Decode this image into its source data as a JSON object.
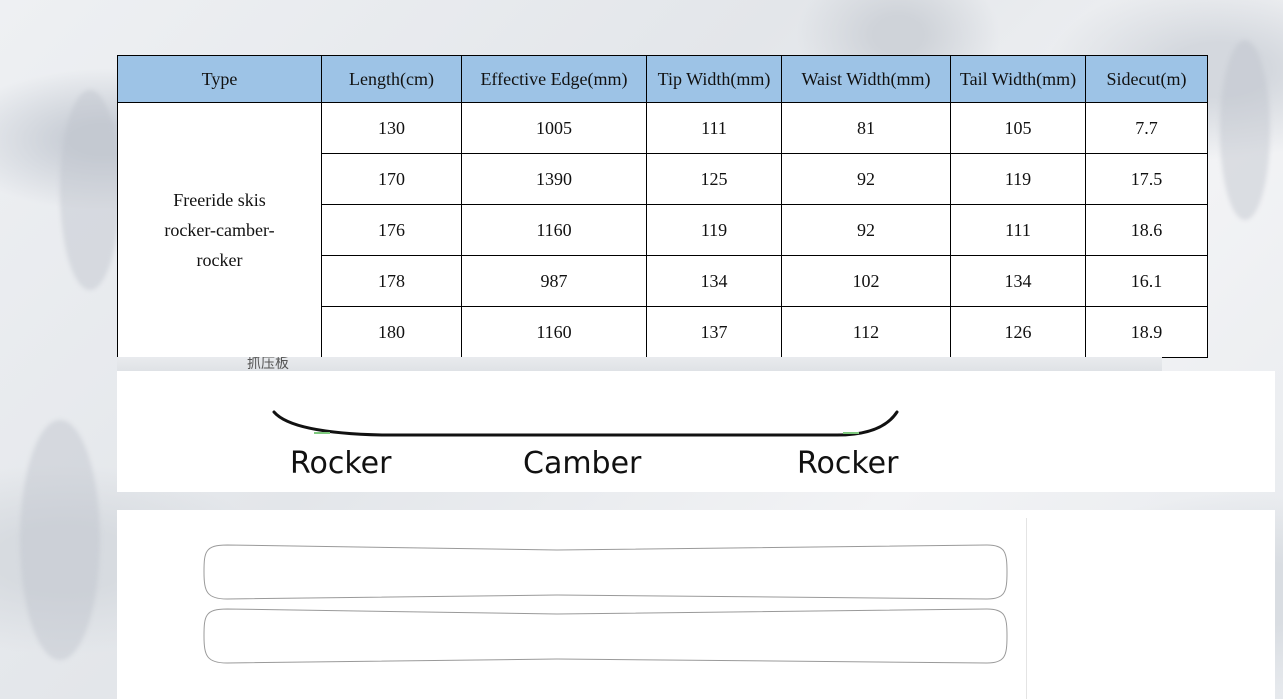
{
  "table": {
    "headers": [
      "Type",
      "Length(cm)",
      "Effective Edge(mm)",
      "Tip Width(mm)",
      "Waist Width(mm)",
      "Tail Width(mm)",
      "Sidecut(m)"
    ],
    "type_lines": [
      "Freeride skis",
      "rocker-camber-",
      "rocker"
    ],
    "rows": [
      [
        "130",
        "1005",
        "111",
        "81",
        "105",
        "7.7"
      ],
      [
        "170",
        "1390",
        "125",
        "92",
        "119",
        "17.5"
      ],
      [
        "176",
        "1160",
        "119",
        "92",
        "111",
        "18.6"
      ],
      [
        "178",
        "987",
        "134",
        "102",
        "134",
        "16.1"
      ],
      [
        "180",
        "1160",
        "137",
        "112",
        "126",
        "18.9"
      ]
    ],
    "header_color": "#9dc3e6"
  },
  "strip": {
    "text": "抓压板"
  },
  "profile": {
    "labels": {
      "left": "Rocker",
      "center": "Camber",
      "right": "Rocker"
    }
  },
  "icons": {
    "profile": "ski-profile-curve-icon",
    "outline": "ski-outline-icon"
  }
}
